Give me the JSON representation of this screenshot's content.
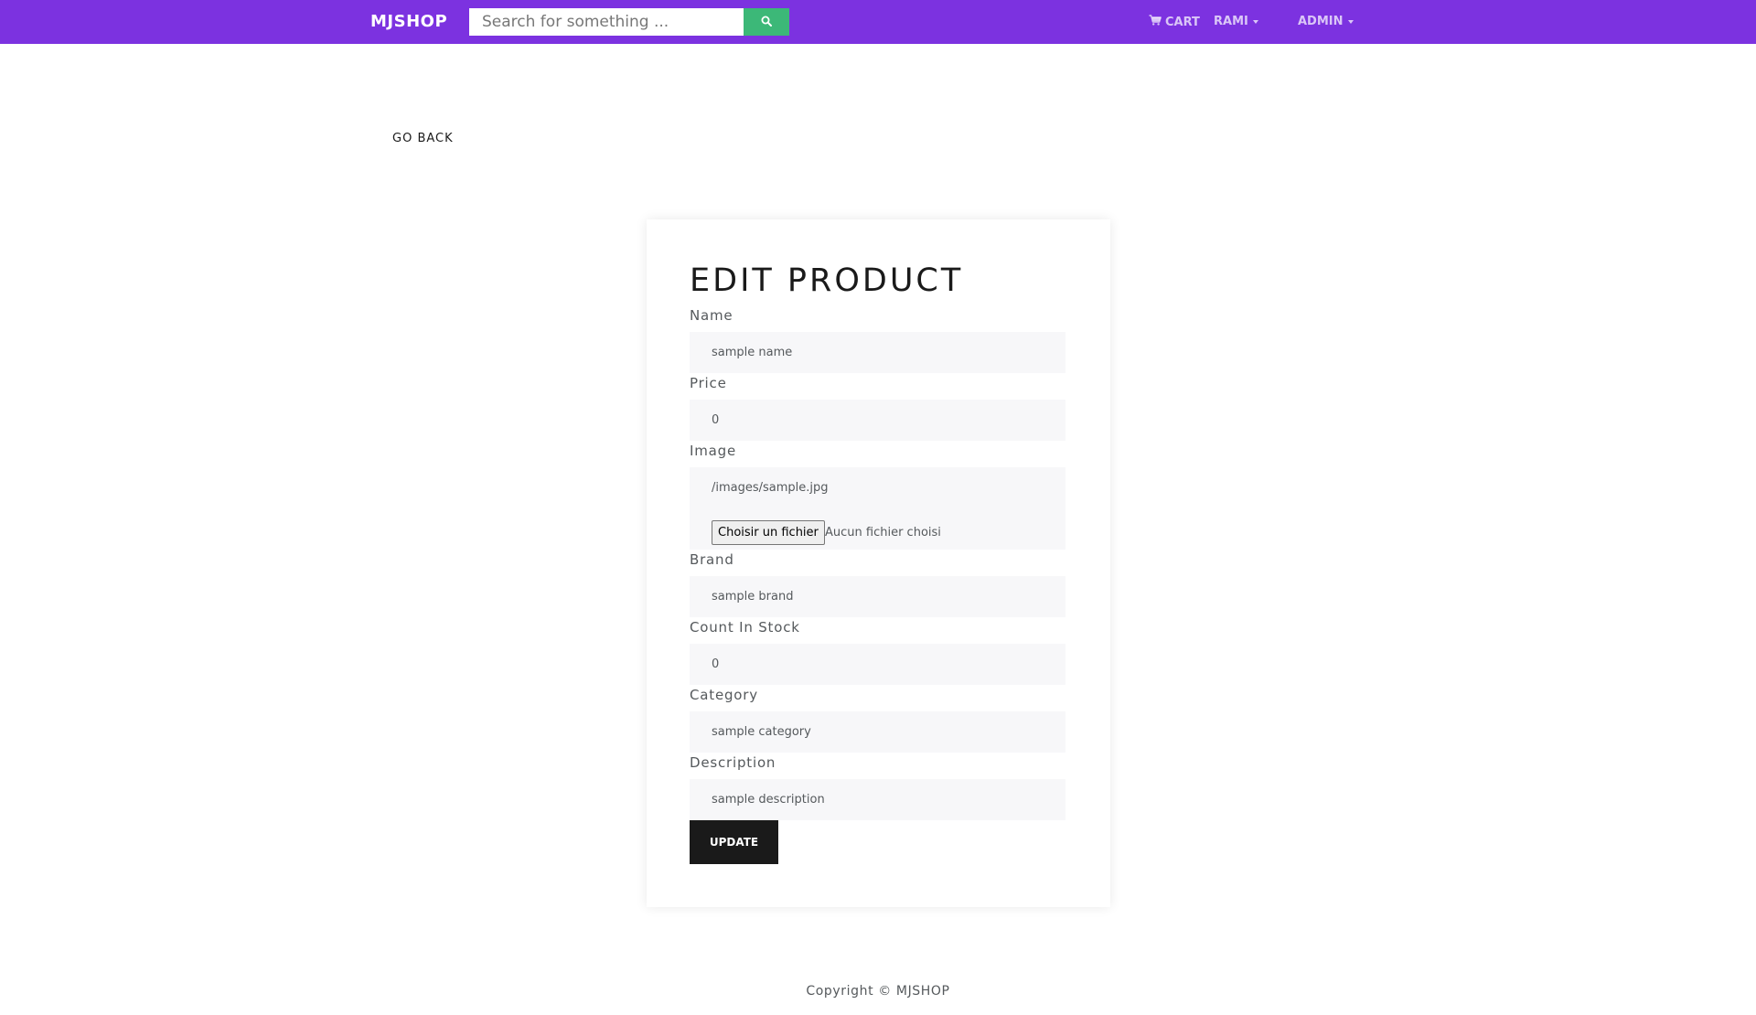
{
  "header": {
    "brand": "MJSHOP",
    "search_placeholder": "Search for something ...",
    "cart_label": "CART",
    "user_menu_label": "RAMI",
    "admin_menu_label": "ADMIN"
  },
  "page": {
    "back_label": "GO BACK",
    "title": "EDIT PRODUCT"
  },
  "form": {
    "name": {
      "label": "Name",
      "value": "sample name"
    },
    "price": {
      "label": "Price",
      "value": "0"
    },
    "image": {
      "label": "Image",
      "value": "/images/sample.jpg",
      "file_button_label": "Choisir un fichier",
      "file_status": "Aucun fichier choisi"
    },
    "brand": {
      "label": "Brand",
      "value": "sample brand"
    },
    "count_in_stock": {
      "label": "Count In Stock",
      "value": "0"
    },
    "category": {
      "label": "Category",
      "value": "sample category"
    },
    "description": {
      "label": "Description",
      "value": "sample description"
    },
    "submit_label": "UPDATE"
  },
  "footer": {
    "copyright": "Copyright © MJSHOP"
  },
  "colors": {
    "navbar": "#7c32e0",
    "search_button": "#3cb878",
    "update_button": "#1a1a1a",
    "input_background": "#f7f7f9"
  }
}
